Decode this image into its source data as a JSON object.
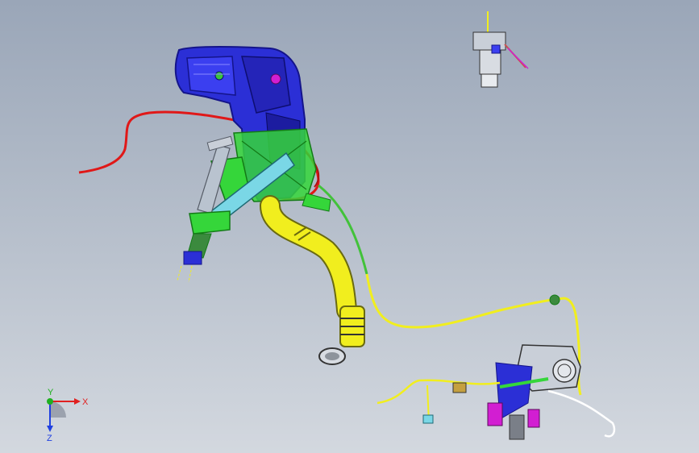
{
  "viewport": {
    "background_top": "#9aa6b8",
    "background_bottom": "#d3d8df"
  },
  "model": {
    "colors": {
      "housing": "#2b2fd6",
      "housing_dark": "#14148a",
      "bracket": "#35d63a",
      "hose": "#f1ee1e",
      "hose_dark": "#6a6a10",
      "cable_red": "#e01818",
      "cable_green": "#42c23a",
      "accent_magenta": "#d21ed2",
      "steel": "#c9cfd8",
      "steel_dark": "#555b66"
    }
  },
  "triad": {
    "x_label": "X",
    "y_label": "Y",
    "z_label": "Z",
    "x_color": "#e02020",
    "y_color": "#20b020",
    "z_color": "#2040e0"
  }
}
